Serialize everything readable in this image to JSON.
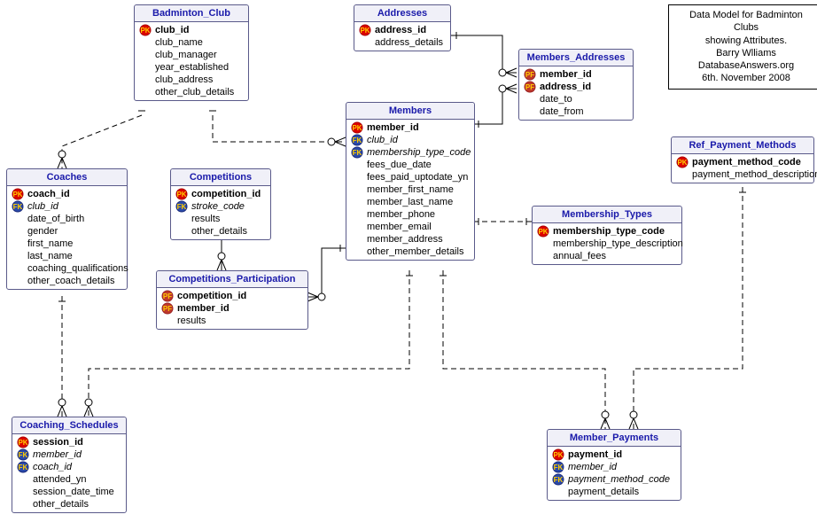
{
  "info": {
    "line1": "Data Model for Badminton Clubs",
    "line2": "showing Attributes.",
    "line3": "Barry Wlliams",
    "line4": "DatabaseAnswers.org",
    "line5": "6th. November 2008"
  },
  "entities": {
    "badminton_club": {
      "title": "Badminton_Club",
      "attrs": [
        {
          "name": "club_id",
          "key": "PK",
          "bold": true
        },
        {
          "name": "club_name"
        },
        {
          "name": "club_manager"
        },
        {
          "name": "year_established"
        },
        {
          "name": "club_address"
        },
        {
          "name": "other_club_details"
        }
      ]
    },
    "addresses": {
      "title": "Addresses",
      "attrs": [
        {
          "name": "address_id",
          "key": "PK",
          "bold": true
        },
        {
          "name": "address_details"
        }
      ]
    },
    "members_addresses": {
      "title": "Members_Addresses",
      "attrs": [
        {
          "name": "member_id",
          "key": "PF",
          "bold": true
        },
        {
          "name": "address_id",
          "key": "PF",
          "bold": true
        },
        {
          "name": "date_to"
        },
        {
          "name": "date_from"
        }
      ]
    },
    "members": {
      "title": "Members",
      "attrs": [
        {
          "name": "member_id",
          "key": "PK",
          "bold": true
        },
        {
          "name": "club_id",
          "key": "FK",
          "italic": true
        },
        {
          "name": "membership_type_code",
          "key": "FK",
          "italic": true
        },
        {
          "name": "fees_due_date"
        },
        {
          "name": "fees_paid_uptodate_yn"
        },
        {
          "name": "member_first_name"
        },
        {
          "name": "member_last_name"
        },
        {
          "name": "member_phone"
        },
        {
          "name": "member_email"
        },
        {
          "name": "member_address"
        },
        {
          "name": "other_member_details"
        }
      ]
    },
    "ref_payment_methods": {
      "title": "Ref_Payment_Methods",
      "attrs": [
        {
          "name": "payment_method_code",
          "key": "PK",
          "bold": true
        },
        {
          "name": "payment_method_description"
        }
      ]
    },
    "coaches": {
      "title": "Coaches",
      "attrs": [
        {
          "name": "coach_id",
          "key": "PK",
          "bold": true
        },
        {
          "name": "club_id",
          "key": "FK",
          "italic": true
        },
        {
          "name": "date_of_birth"
        },
        {
          "name": "gender"
        },
        {
          "name": "first_name"
        },
        {
          "name": "last_name"
        },
        {
          "name": "coaching_qualifications"
        },
        {
          "name": "other_coach_details"
        }
      ]
    },
    "competitions": {
      "title": "Competitions",
      "attrs": [
        {
          "name": "competition_id",
          "key": "PK",
          "bold": true
        },
        {
          "name": "stroke_code",
          "key": "FK",
          "italic": true
        },
        {
          "name": "results"
        },
        {
          "name": "other_details"
        }
      ]
    },
    "membership_types": {
      "title": "Membership_Types",
      "attrs": [
        {
          "name": "membership_type_code",
          "key": "PK",
          "bold": true
        },
        {
          "name": "membership_type_description"
        },
        {
          "name": "annual_fees"
        }
      ]
    },
    "competitions_participation": {
      "title": "Competitions_Participation",
      "attrs": [
        {
          "name": "competition_id",
          "key": "PF",
          "bold": true
        },
        {
          "name": "member_id",
          "key": "PF",
          "bold": true
        },
        {
          "name": "results"
        }
      ]
    },
    "coaching_schedules": {
      "title": "Coaching_Schedules",
      "attrs": [
        {
          "name": "session_id",
          "key": "PK",
          "bold": true
        },
        {
          "name": "member_id",
          "key": "FK",
          "italic": true
        },
        {
          "name": "coach_id",
          "key": "FK",
          "italic": true
        },
        {
          "name": "attended_yn"
        },
        {
          "name": "session_date_time"
        },
        {
          "name": "other_details"
        }
      ]
    },
    "member_payments": {
      "title": "Member_Payments",
      "attrs": [
        {
          "name": "payment_id",
          "key": "PK",
          "bold": true
        },
        {
          "name": "member_id",
          "key": "FK",
          "italic": true
        },
        {
          "name": "payment_method_code",
          "key": "FK",
          "italic": true
        },
        {
          "name": "payment_details"
        }
      ]
    }
  }
}
